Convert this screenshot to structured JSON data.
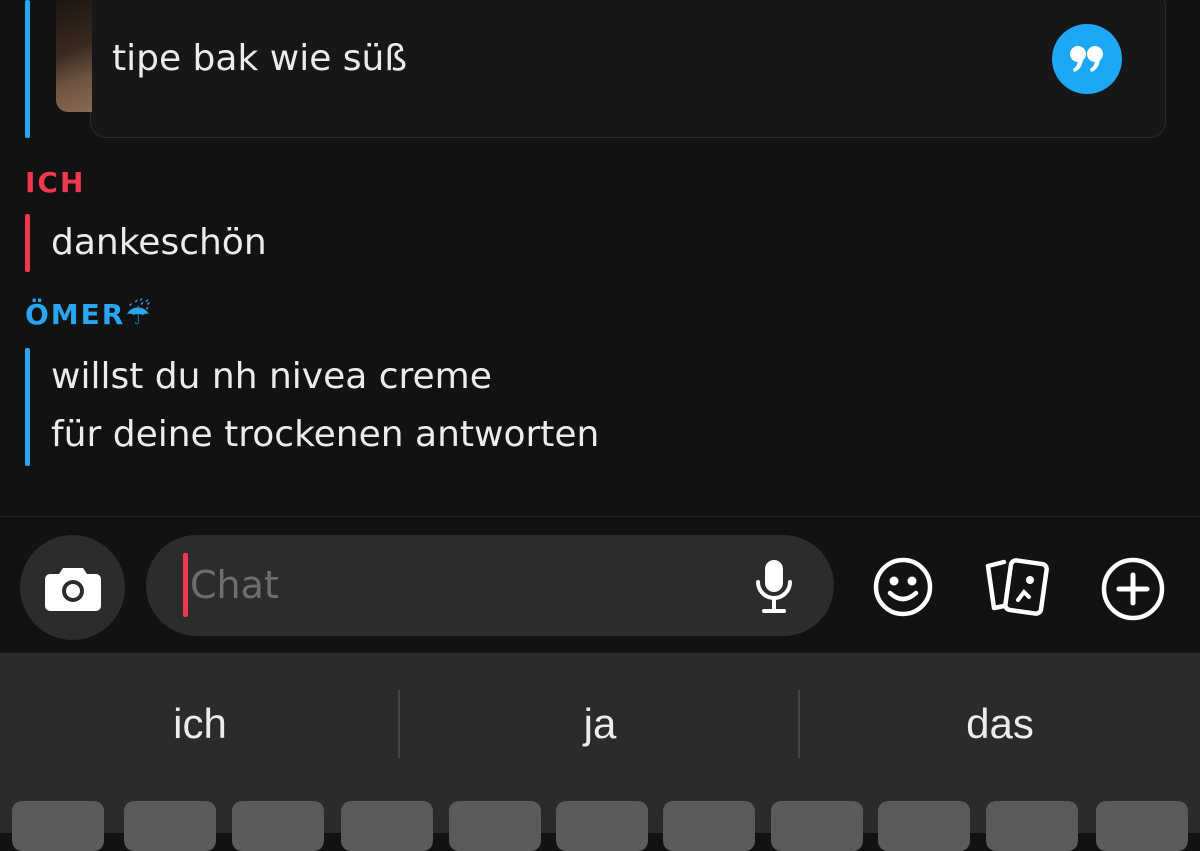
{
  "quoted": {
    "text": "tipe bak wie süß"
  },
  "messages": [
    {
      "sender": "ICH",
      "lines": [
        "dankeschön"
      ]
    },
    {
      "sender": "ÖMER☔",
      "lines": [
        "willst du nh nivea creme",
        "für deine trockenen antworten"
      ]
    }
  ],
  "composer": {
    "placeholder": "Chat",
    "value": ""
  },
  "keyboard": {
    "suggestions": [
      "ich",
      "ja",
      "das"
    ]
  },
  "colors": {
    "me": "#f2384e",
    "other": "#29a6ef",
    "quote_badge": "#1ca8f4"
  },
  "icons": [
    "quote-icon",
    "camera-icon",
    "microphone-icon",
    "emoji-icon",
    "cards-icon",
    "plus-icon"
  ]
}
